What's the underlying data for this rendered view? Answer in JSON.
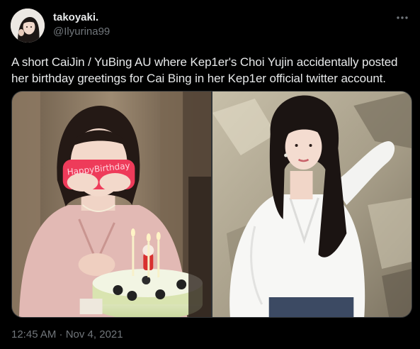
{
  "tweet": {
    "display_name": "takoyaki.",
    "handle": "@Ilyurina99",
    "text": "A short CaiJin / YuBing AU where Kep1er's Choi Yujin accidentally posted her birthday greetings for Cai Bing in her Kep1er official twitter account.",
    "timestamp": "12:45 AM · Nov 4, 2021",
    "glasses_text": "HappyBirthday"
  },
  "icons": {
    "more": "more-horizontal-icon"
  },
  "colors": {
    "background": "#000000",
    "text_primary": "#e7e9ea",
    "text_secondary": "#71767b",
    "border": "#2f3336"
  }
}
